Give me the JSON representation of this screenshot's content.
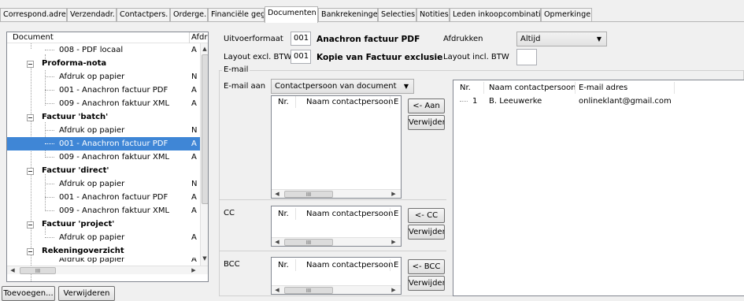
{
  "tabs": [
    {
      "label": "Correspond.adres"
    },
    {
      "label": "Verzendadr."
    },
    {
      "label": "Contactpers."
    },
    {
      "label": "Orderge."
    },
    {
      "label": "Financiële geg."
    },
    {
      "label": "Documenten"
    },
    {
      "label": "Bankrekeningen"
    },
    {
      "label": "Selecties"
    },
    {
      "label": "Notities"
    },
    {
      "label": "Leden inkoopcombinatie"
    },
    {
      "label": "Opmerkingen"
    }
  ],
  "tree": {
    "col_document": "Document",
    "col_afdruk": "Afdru",
    "rows": [
      {
        "label": "008 - PDF locaal",
        "value": "A"
      },
      {
        "label": "Proforma-nota",
        "value": ""
      },
      {
        "label": "Afdruk op papier",
        "value": "N"
      },
      {
        "label": "001 - Anachron factuur PDF",
        "value": "A"
      },
      {
        "label": "009 - Anachron faktuur XML",
        "value": "A"
      },
      {
        "label": "Factuur 'batch'",
        "value": ""
      },
      {
        "label": "Afdruk op papier",
        "value": "N"
      },
      {
        "label": "001 - Anachron factuur PDF",
        "value": "A"
      },
      {
        "label": "009 - Anachron faktuur XML",
        "value": "A"
      },
      {
        "label": "Factuur 'direct'",
        "value": ""
      },
      {
        "label": "Afdruk op papier",
        "value": "N"
      },
      {
        "label": "001 - Anachron factuur PDF",
        "value": "A"
      },
      {
        "label": "009 - Anachron faktuur XML",
        "value": "A"
      },
      {
        "label": "Factuur 'project'",
        "value": ""
      },
      {
        "label": "Afdruk op papier",
        "value": "A"
      },
      {
        "label": "Rekeningoverzicht",
        "value": ""
      },
      {
        "label": "Afdruk op papier",
        "value": "A"
      }
    ],
    "scroll_glyph": "III"
  },
  "buttons": {
    "add": "Toevoegen...",
    "remove": "Verwijderen",
    "to_aan": "<- Aan",
    "to_cc": "<- CC",
    "to_bcc": "<- BCC",
    "verwijder": "Verwijder"
  },
  "form": {
    "uitvoerformaat_label": "Uitvoerformaat",
    "uitvoerformaat_value": "001",
    "uitvoerformaat_desc": "Anachron factuur PDF",
    "afdrukken_label": "Afdrukken",
    "afdrukken_value": "Altijd",
    "layout_excl_label": "Layout excl. BTW",
    "layout_excl_value": "001",
    "layout_excl_desc": "Kopie van Factuur exclusief",
    "layout_incl_label": "Layout incl. BTW",
    "layout_incl_value": ""
  },
  "email": {
    "group_label": "E-mail",
    "aan_label": "E-mail aan",
    "aan_combo": "Contactpersoon van document",
    "cc_label": "CC",
    "bcc_label": "BCC",
    "sub_cols": [
      "Nr.",
      "Naam contactpersoon",
      "E"
    ],
    "contacts": {
      "cols": [
        "Nr.",
        "Naam contactpersoon",
        "E-mail adres"
      ],
      "rows": [
        {
          "nr": "1",
          "name": "B. Leeuwerke",
          "email": "onlineklant@gmail.com"
        }
      ]
    }
  },
  "colors": {
    "selection": "#3f86d6",
    "panel": "#f0f0f0",
    "tab_border": "#b5b5b5"
  }
}
